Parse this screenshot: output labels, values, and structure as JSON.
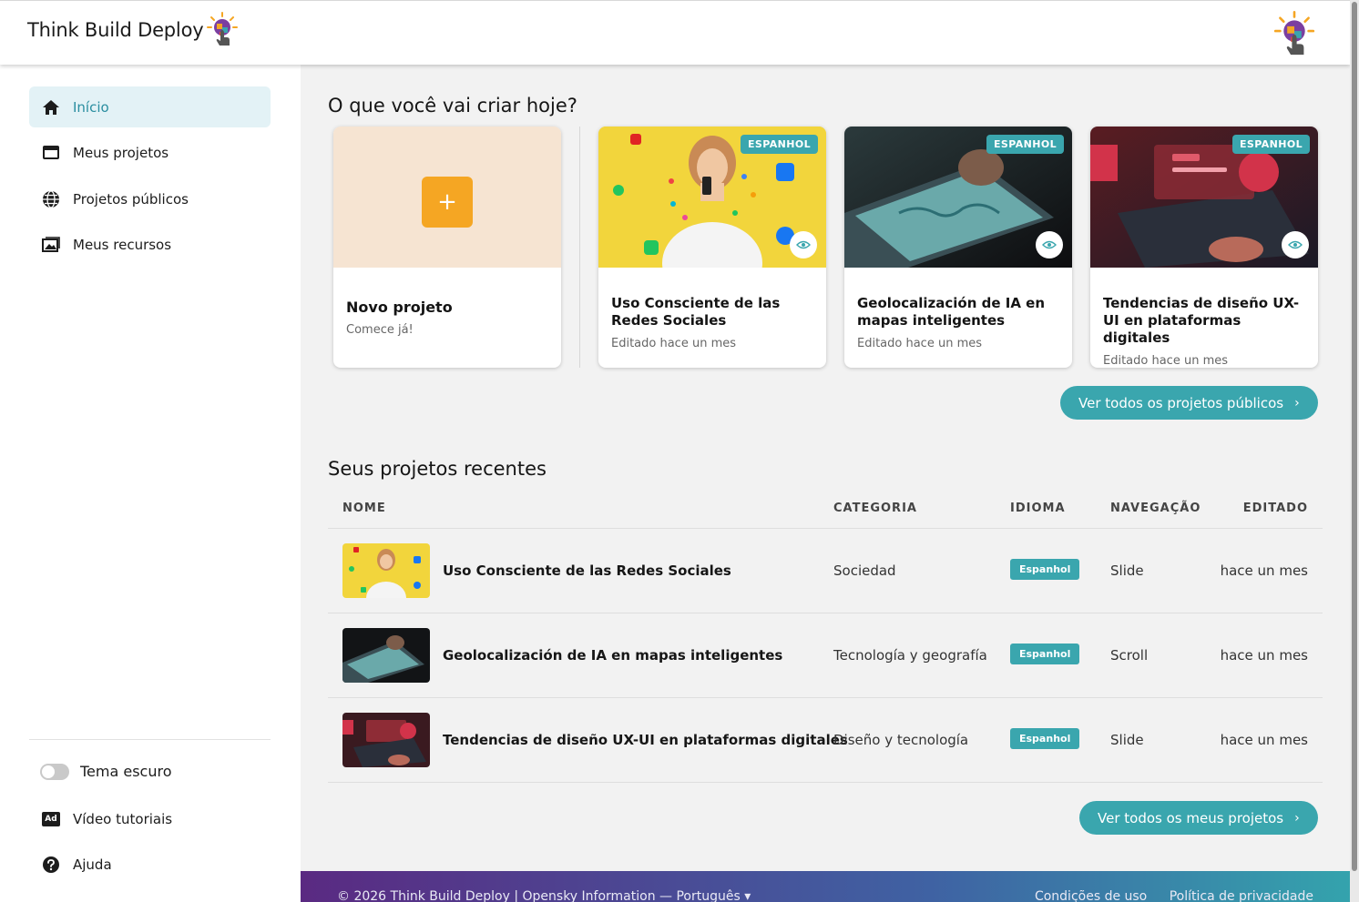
{
  "header": {
    "brand": "Think Build Deploy"
  },
  "sidebar": {
    "items": [
      {
        "label": "Início",
        "icon": "home-icon",
        "active": true
      },
      {
        "label": "Meus projetos",
        "icon": "window-icon"
      },
      {
        "label": "Projetos públicos",
        "icon": "globe-icon"
      },
      {
        "label": "Meus recursos",
        "icon": "image-icon"
      }
    ],
    "bottom": {
      "dark_theme": "Tema escuro",
      "video_tutorials": "Vídeo tutoriais",
      "video_icon_text": "Ad",
      "help": "Ajuda"
    }
  },
  "create": {
    "title": "O que você vai criar hoje?",
    "new_project": {
      "title": "Novo projeto",
      "subtitle": "Comece já!",
      "plus": "+"
    },
    "cards": [
      {
        "badge": "ESPANHOL",
        "title": "Uso Consciente de las Redes Sociales",
        "subtitle": "Editado hace un mes"
      },
      {
        "badge": "ESPANHOL",
        "title": "Geolocalización de IA en mapas inteligentes",
        "subtitle": "Editado hace un mes"
      },
      {
        "badge": "ESPANHOL",
        "title": "Tendencias de diseño UX-UI en plataformas digitales",
        "subtitle": "Editado hace un mes"
      }
    ],
    "see_all_public": "Ver todos os projetos públicos"
  },
  "recent": {
    "title": "Seus projetos recentes",
    "columns": {
      "name": "NOME",
      "category": "CATEGORIA",
      "language": "IDIOMA",
      "navigation": "NAVEGAÇÃO",
      "edited": "EDITADO"
    },
    "rows": [
      {
        "name": "Uso Consciente de las Redes Sociales",
        "category": "Sociedad",
        "language": "Espanhol",
        "navigation": "Slide",
        "edited": "hace un mes"
      },
      {
        "name": "Geolocalización de IA en mapas inteligentes",
        "category": "Tecnología y geografía",
        "language": "Espanhol",
        "navigation": "Scroll",
        "edited": "hace un mes"
      },
      {
        "name": "Tendencias de diseño UX-UI en plataformas digitales",
        "category": "Diseño y tecnología",
        "language": "Espanhol",
        "navigation": "Slide",
        "edited": "hace un mes"
      }
    ],
    "see_all_mine": "Ver todos os meus projetos"
  },
  "footer": {
    "copyright": "© 2026 Think Build Deploy | Opensky Information —",
    "language": "Português",
    "terms": "Condições de uso",
    "privacy": "Política de privacidade"
  },
  "colors": {
    "accent": "#3aa6ae",
    "orange": "#f5a623",
    "active_bg": "#e3f2f6"
  }
}
